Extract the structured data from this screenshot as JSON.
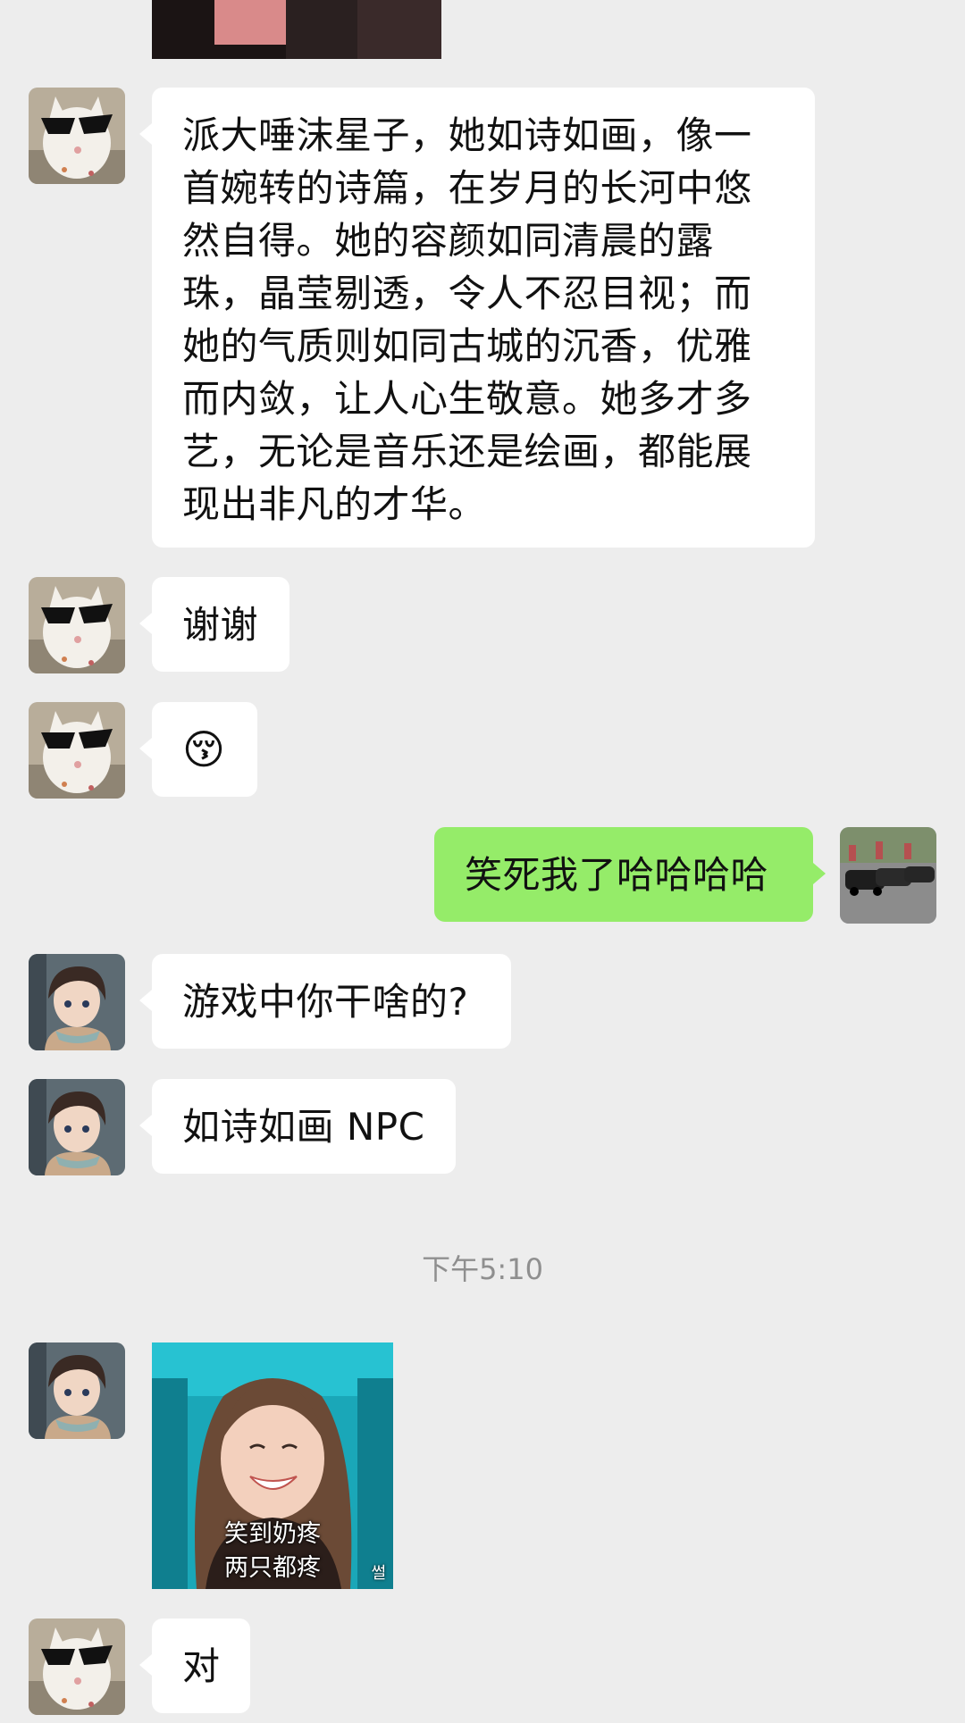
{
  "messages": [
    {
      "id": "m1",
      "sender": "cat",
      "text": "派大唾沫星子，她如诗如画，像一首婉转的诗篇，在岁月的长河中悠然自得。她的容颜如同清晨的露珠，晶莹剔透，令人不忍目视；而她的气质则如同古城的沉香，优雅而内敛，让人心生敬意。她多才多艺，无论是音乐还是绘画，都能展现出非凡的才华。"
    },
    {
      "id": "m2",
      "sender": "cat",
      "text": "谢谢"
    },
    {
      "id": "m3",
      "sender": "cat",
      "emoji": "😚"
    },
    {
      "id": "m4",
      "sender": "self",
      "text": "笑死我了哈哈哈哈"
    },
    {
      "id": "m5",
      "sender": "boy",
      "text": "游戏中你干啥的?"
    },
    {
      "id": "m6",
      "sender": "boy",
      "text": "如诗如画 NPC"
    },
    {
      "id": "m7",
      "sender": "boy",
      "sticker_caption_1": "笑到奶疼",
      "sticker_caption_2": "两只都疼",
      "sticker_mark": "썰"
    },
    {
      "id": "m8",
      "sender": "cat",
      "text": "对"
    }
  ],
  "timestamp": "下午5:10",
  "colors": {
    "background": "#ededed",
    "bubble_in": "#ffffff",
    "bubble_out": "#95ec69",
    "timestamp": "#8f8f8f"
  },
  "icons": {
    "cat_avatar": "cat-sunglasses-avatar-icon",
    "boy_avatar": "anime-boy-avatar-icon",
    "self_avatar": "cars-avatar-icon"
  }
}
